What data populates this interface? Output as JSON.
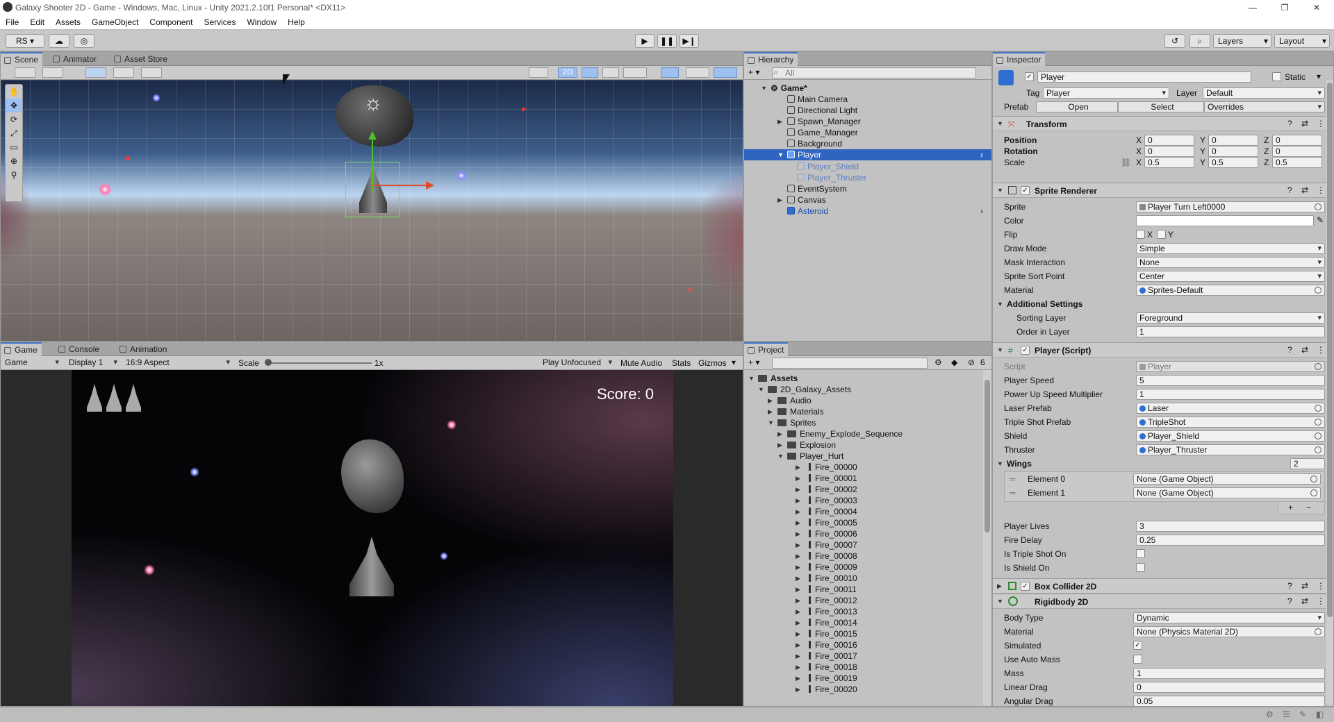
{
  "window": {
    "title": "Galaxy Shooter 2D - Game - Windows, Mac, Linux - Unity 2021.2.10f1 Personal* <DX11>"
  },
  "menu": [
    "File",
    "Edit",
    "Assets",
    "GameObject",
    "Component",
    "Services",
    "Window",
    "Help"
  ],
  "toolbar": {
    "account": "RS",
    "layers": "Layers",
    "layout": "Layout"
  },
  "scene_tabs": [
    "Scene",
    "Animator",
    "Asset Store"
  ],
  "scene_toolbar": {
    "mode_2d": "2D"
  },
  "game_tabs": [
    "Game",
    "Console",
    "Animation"
  ],
  "game_toolbar": {
    "view": "Game",
    "display": "Display 1",
    "aspect": "16:9 Aspect",
    "scale_label": "Scale",
    "scale_value": "1x",
    "play_mode": "Play Unfocused",
    "mute": "Mute Audio",
    "stats": "Stats",
    "gizmos": "Gizmos"
  },
  "game_view": {
    "score": "Score: 0",
    "lives": 3
  },
  "hierarchy": {
    "tab": "Hierarchy",
    "search_placeholder": "All",
    "root": "Game*",
    "items": [
      "Main Camera",
      "Directional Light",
      "Spawn_Manager",
      "Game_Manager",
      "Background",
      "Player",
      "Player_Shield",
      "Player_Thruster",
      "EventSystem",
      "Canvas",
      "Asteroid"
    ]
  },
  "project": {
    "tab": "Project",
    "badge": "6",
    "root": "Assets",
    "folders": [
      "2D_Galaxy_Assets",
      "Audio",
      "Materials",
      "Sprites",
      "Enemy_Explode_Sequence",
      "Explosion",
      "Player_Hurt"
    ],
    "files": [
      "Fire_00000",
      "Fire_00001",
      "Fire_00002",
      "Fire_00003",
      "Fire_00004",
      "Fire_00005",
      "Fire_00006",
      "Fire_00007",
      "Fire_00008",
      "Fire_00009",
      "Fire_00010",
      "Fire_00011",
      "Fire_00012",
      "Fire_00013",
      "Fire_00014",
      "Fire_00015",
      "Fire_00016",
      "Fire_00017",
      "Fire_00018",
      "Fire_00019",
      "Fire_00020"
    ]
  },
  "inspector": {
    "tab": "Inspector",
    "object_name": "Player",
    "static_label": "Static",
    "tag_label": "Tag",
    "tag": "Player",
    "layer_label": "Layer",
    "layer": "Default",
    "prefab_label": "Prefab",
    "open": "Open",
    "select": "Select",
    "overrides": "Overrides",
    "transform": {
      "title": "Transform",
      "position_label": "Position",
      "rotation_label": "Rotation",
      "scale_label": "Scale",
      "axis": [
        "X",
        "Y",
        "Z"
      ],
      "position": [
        "0",
        "0",
        "0"
      ],
      "rotation": [
        "0",
        "0",
        "0"
      ],
      "scale": [
        "0.5",
        "0.5",
        "0.5"
      ]
    },
    "sprite_renderer": {
      "title": "Sprite Renderer",
      "sprite_label": "Sprite",
      "sprite": "Player Turn Left0000",
      "color_label": "Color",
      "flip_label": "Flip",
      "flip_x": "X",
      "flip_y": "Y",
      "draw_mode_label": "Draw Mode",
      "draw_mode": "Simple",
      "mask_label": "Mask Interaction",
      "mask": "None",
      "sort_point_label": "Sprite Sort Point",
      "sort_point": "Center",
      "material_label": "Material",
      "material": "Sprites-Default",
      "additional_label": "Additional Settings",
      "sorting_layer_label": "Sorting Layer",
      "sorting_layer": "Foreground",
      "order_label": "Order in Layer",
      "order": "1"
    },
    "player_script": {
      "title": "Player (Script)",
      "script_label": "Script",
      "script": "Player",
      "speed_label": "Player Speed",
      "speed": "5",
      "powerup_label": "Power Up Speed Multiplier",
      "powerup": "1",
      "laser_label": "Laser Prefab",
      "laser": "Laser",
      "triple_label": "Triple Shot Prefab",
      "triple": "TripleShot",
      "shield_label": "Shield",
      "shield": "Player_Shield",
      "thruster_label": "Thruster",
      "thruster": "Player_Thruster",
      "wings_label": "Wings",
      "wings_count": "2",
      "elements": [
        {
          "label": "Element 0",
          "value": "None (Game Object)"
        },
        {
          "label": "Element 1",
          "value": "None (Game Object)"
        }
      ],
      "lives_label": "Player Lives",
      "lives": "3",
      "fire_delay_label": "Fire Delay",
      "fire_delay": "0.25",
      "triple_on_label": "Is Triple Shot On",
      "shield_on_label": "Is Shield On"
    },
    "box_collider": {
      "title": "Box Collider 2D"
    },
    "rigidbody": {
      "title": "Rigidbody 2D",
      "body_type_label": "Body Type",
      "body_type": "Dynamic",
      "material_label": "Material",
      "material": "None (Physics Material 2D)",
      "simulated_label": "Simulated",
      "auto_mass_label": "Use Auto Mass",
      "mass_label": "Mass",
      "mass": "1",
      "linear_drag_label": "Linear Drag",
      "linear_drag": "0",
      "angular_drag_label": "Angular Drag",
      "angular_drag": "0.05"
    }
  }
}
